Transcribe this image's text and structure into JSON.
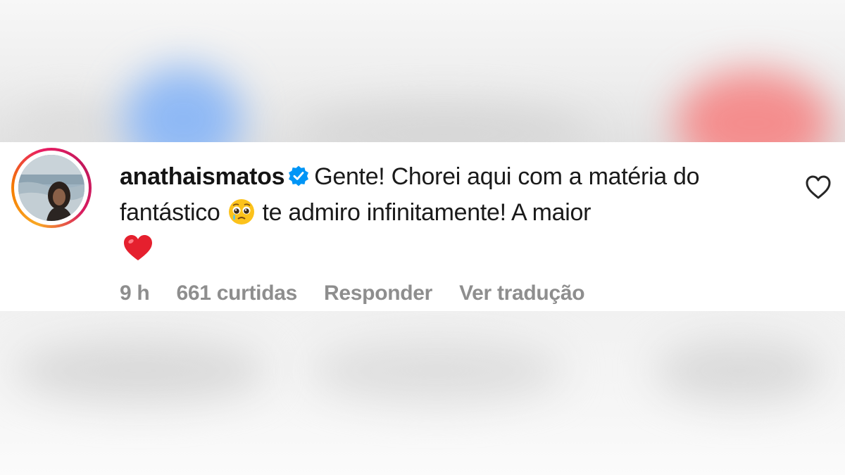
{
  "comment": {
    "username": "anathaismatos",
    "verified_icon": "verified-badge-icon",
    "text_part1": "Gente! Chorei aqui com a matéria do fantástico",
    "emoji_1": "pleading-crying-face-emoji",
    "text_part2": "te admiro infinitamente! A maior",
    "emoji_2": "red-heart-emoji",
    "like_icon": "heart-outline-icon"
  },
  "meta": {
    "time": "9 h",
    "likes": "661 curtidas",
    "reply_label": "Responder",
    "translate_label": "Ver tradução"
  },
  "colors": {
    "verified_blue": "#0095f6",
    "meta_grey": "#8e8e8e",
    "text": "#1a1a1a"
  }
}
